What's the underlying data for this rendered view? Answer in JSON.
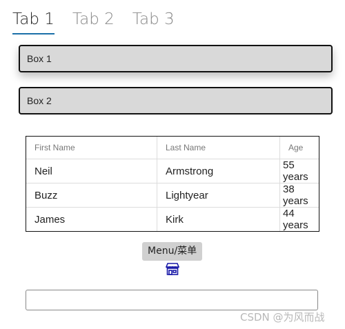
{
  "tabs": [
    {
      "label": "Tab 1",
      "active": true
    },
    {
      "label": "Tab 2",
      "active": false
    },
    {
      "label": "Tab 3",
      "active": false
    }
  ],
  "boxes": [
    {
      "label": "Box 1"
    },
    {
      "label": "Box 2"
    }
  ],
  "table": {
    "headers": [
      "First Name",
      "Last Name",
      "Age"
    ],
    "rows": [
      [
        "Neil",
        "Armstrong",
        "55 years"
      ],
      [
        "Buzz",
        "Lightyear",
        "38 years"
      ],
      [
        "James",
        "Kirk",
        "44 years"
      ]
    ]
  },
  "menu_button": {
    "label": "Menu/菜单"
  },
  "store_icon": {
    "name": "store-icon",
    "color": "#1a1aa8"
  },
  "input": {
    "value": "",
    "placeholder": ""
  },
  "watermark": "CSDN @为风而战",
  "colors": {
    "tab_underline": "#1a6fa8",
    "box_bg": "#d9d9d9",
    "button_bg": "#d0d0d0"
  }
}
